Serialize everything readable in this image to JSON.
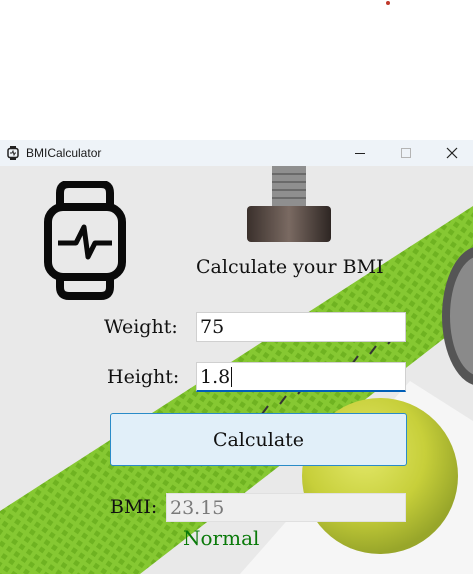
{
  "window": {
    "title": "BMICalculator"
  },
  "form": {
    "heading": "Calculate your BMI",
    "weight_label": "Weight:",
    "weight_value": "75",
    "height_label": "Height:",
    "height_value": "1.8",
    "calculate_label": "Calculate",
    "bmi_label": "BMI:",
    "bmi_value": "23.15",
    "category": "Normal"
  },
  "colors": {
    "button_bg": "#e1eff9",
    "button_border": "#2a8bc8",
    "category_text": "#0a7a0a",
    "focus_underline": "#005fb8"
  },
  "icons": {
    "app": "smartwatch-icon",
    "logo": "smartwatch-heartbeat-icon",
    "minimize": "minimize-icon",
    "maximize": "maximize-icon",
    "close": "close-icon"
  }
}
